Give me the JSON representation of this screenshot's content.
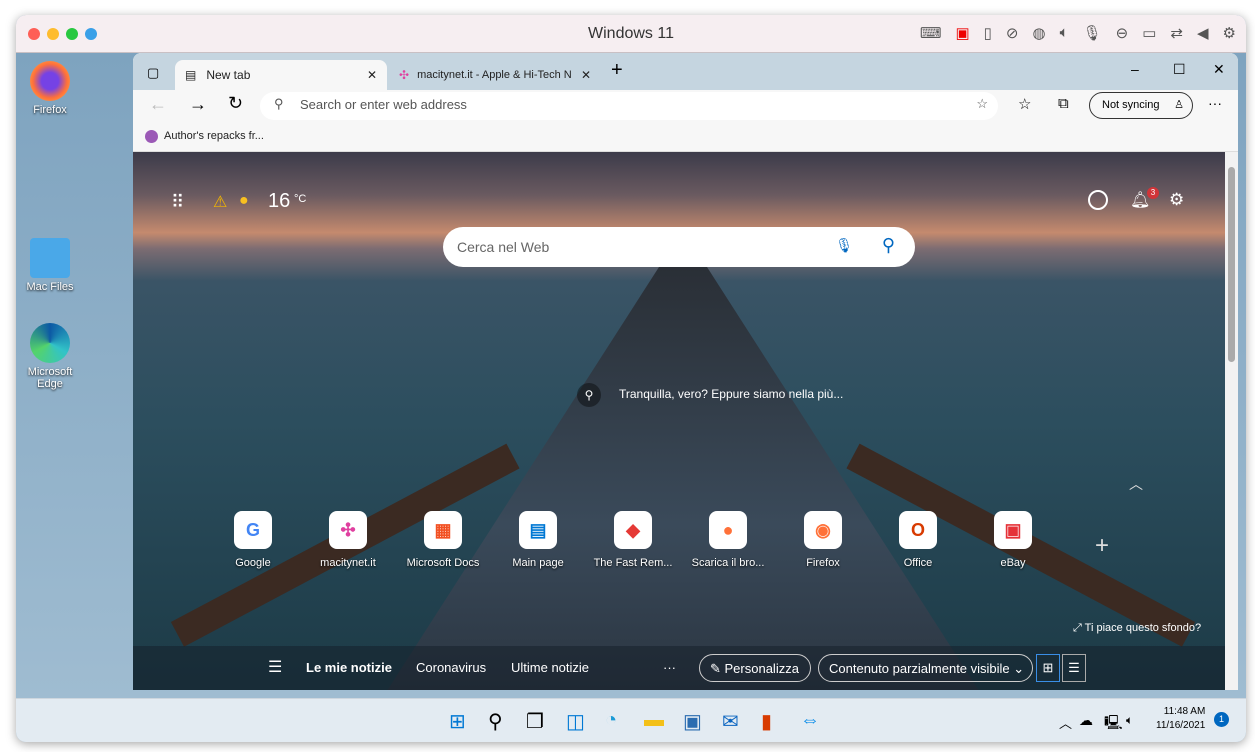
{
  "window": {
    "title": "Windows 11"
  },
  "desktop": {
    "icons": [
      {
        "label": "Firefox"
      },
      {
        "label": "Mac Files"
      },
      {
        "label": "Microsoft Edge"
      }
    ]
  },
  "browser": {
    "tabs": [
      {
        "label": "New tab",
        "close": "✕"
      },
      {
        "label": "macitynet.it - Apple & Hi-Tech N",
        "close": "✕"
      }
    ],
    "new_tab": "+",
    "window_controls": {
      "minimize": "–",
      "maximize": "☐",
      "close": "✕"
    },
    "address": {
      "placeholder": "Search or enter web address"
    },
    "profile": "Not syncing",
    "more": "···",
    "favorites": [
      {
        "label": "Author's repacks fr..."
      }
    ]
  },
  "newtab": {
    "weather": {
      "temp": "16",
      "unit": "°C"
    },
    "notifications": "3",
    "search_placeholder": "Cerca nel Web",
    "image_caption": "Tranquilla, vero? Eppure siamo nella più...",
    "tiles": [
      {
        "label": "Google",
        "glyph": "G",
        "color": "#4285f4"
      },
      {
        "label": "macitynet.it",
        "glyph": "✣",
        "color": "#e040a0"
      },
      {
        "label": "Microsoft Docs",
        "glyph": "▦",
        "color": "#f25022"
      },
      {
        "label": "Main page",
        "glyph": "▤",
        "color": "#0078d4"
      },
      {
        "label": "The Fast Rem...",
        "glyph": "◆",
        "color": "#e53935"
      },
      {
        "label": "Scarica il bro...",
        "glyph": "●",
        "color": "#ff7139"
      },
      {
        "label": "Firefox",
        "glyph": "◉",
        "color": "#ff7139"
      },
      {
        "label": "Office",
        "glyph": "O",
        "color": "#d83b01"
      },
      {
        "label": "eBay",
        "glyph": "▣",
        "color": "#e53238"
      }
    ],
    "add_tile": "+",
    "like_background": "Ti piace questo sfondo?",
    "news": {
      "tabs": [
        "Le mie notizie",
        "Coronavirus",
        "Ultime notizie"
      ],
      "more": "···",
      "personalize": "Personalizza",
      "visibility": "Contenuto parzialmente visibile"
    }
  },
  "taskbar": {
    "time": "11:48 AM",
    "date": "11/16/2021",
    "badge": "1"
  }
}
